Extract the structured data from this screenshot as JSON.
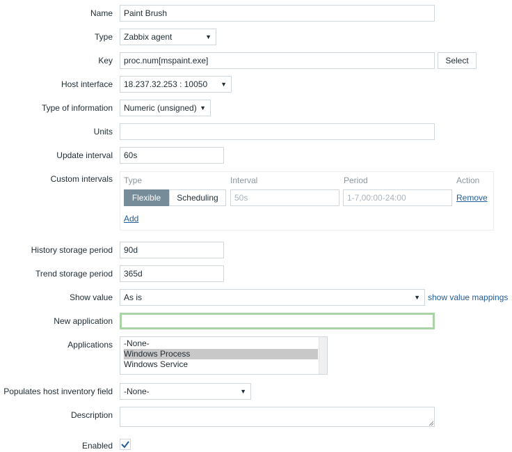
{
  "fields": {
    "name": {
      "label": "Name",
      "value": "Paint Brush"
    },
    "type": {
      "label": "Type",
      "value": "Zabbix agent"
    },
    "key": {
      "label": "Key",
      "value": "proc.num[mspaint.exe]",
      "button": "Select"
    },
    "host_interface": {
      "label": "Host interface",
      "value": "18.237.32.253 : 10050"
    },
    "type_of_information": {
      "label": "Type of information",
      "value": "Numeric (unsigned)"
    },
    "units": {
      "label": "Units",
      "value": ""
    },
    "update_interval": {
      "label": "Update interval",
      "value": "60s"
    },
    "custom_intervals": {
      "label": "Custom intervals",
      "headers": {
        "type": "Type",
        "interval": "Interval",
        "period": "Period",
        "action": "Action"
      },
      "row": {
        "flexible": "Flexible",
        "scheduling": "Scheduling",
        "interval_placeholder": "50s",
        "period_placeholder": "1-7,00:00-24:00",
        "remove": "Remove"
      },
      "add": "Add"
    },
    "history": {
      "label": "History storage period",
      "value": "90d"
    },
    "trend": {
      "label": "Trend storage period",
      "value": "365d"
    },
    "show_value": {
      "label": "Show value",
      "value": "As is",
      "link": "show value mappings"
    },
    "new_application": {
      "label": "New application",
      "value": ""
    },
    "applications": {
      "label": "Applications",
      "options": [
        "-None-",
        "Windows Process",
        "Windows Service"
      ],
      "selected": "Windows Process"
    },
    "inventory": {
      "label": "Populates host inventory field",
      "value": "-None-"
    },
    "description": {
      "label": "Description",
      "value": ""
    },
    "enabled": {
      "label": "Enabled",
      "checked": true
    }
  },
  "colors": {
    "accent": "#768d99",
    "link": "#1f5c99",
    "focus": "#a9d4a5",
    "selected_option": "#c8c8c8"
  }
}
